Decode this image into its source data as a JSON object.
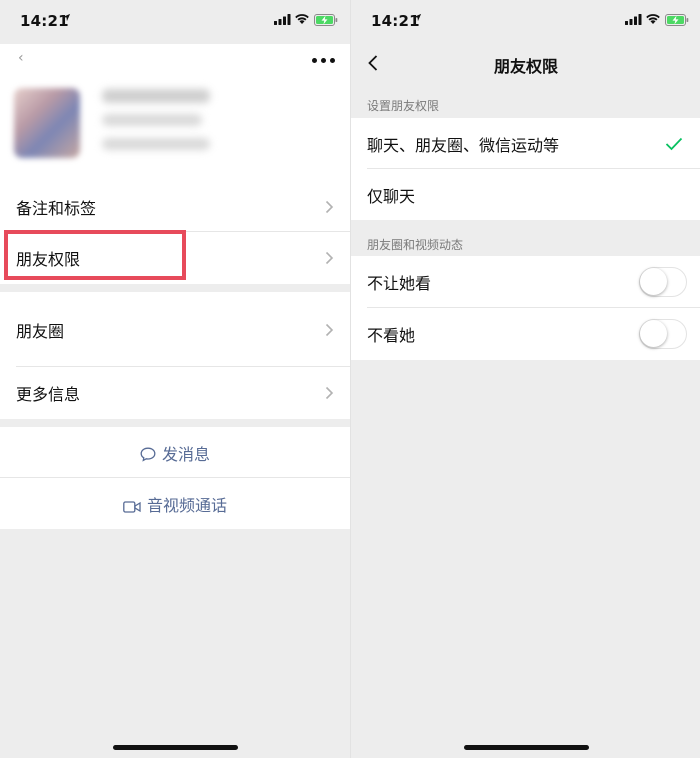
{
  "status_bar": {
    "time": "14:21"
  },
  "left": {
    "rows": [
      {
        "label": "备注和标签"
      },
      {
        "label": "朋友权限"
      },
      {
        "label": "朋友圈"
      },
      {
        "label": "更多信息"
      }
    ],
    "actions": {
      "message": "发消息",
      "call": "音视频通话"
    }
  },
  "right": {
    "title": "朋友权限",
    "section1": {
      "header": "设置朋友权限",
      "options": [
        {
          "label": "聊天、朋友圈、微信运动等",
          "selected": true
        },
        {
          "label": "仅聊天",
          "selected": false
        }
      ]
    },
    "section2": {
      "header": "朋友圈和视频动态",
      "toggles": [
        {
          "label": "不让她看",
          "on": false
        },
        {
          "label": "不看她",
          "on": false
        }
      ]
    }
  },
  "colors": {
    "highlight": "#e74a5b",
    "link": "#576b95",
    "check": "#07c160",
    "background": "#ededed"
  }
}
